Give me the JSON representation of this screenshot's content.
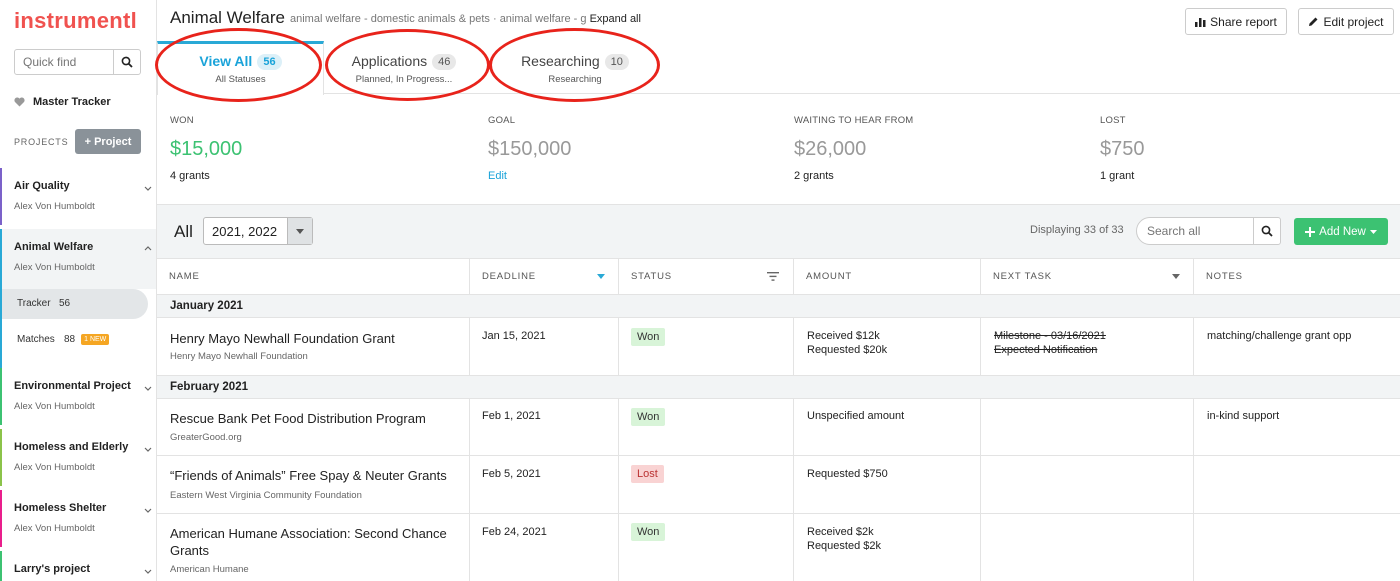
{
  "app": {
    "logo": "instrumentl"
  },
  "sidebar": {
    "quick_find_placeholder": "Quick find",
    "master_tracker": "Master Tracker",
    "projects_header": "PROJECTS",
    "add_project": "+ Project",
    "projects": [
      {
        "name": "Air Quality",
        "owner": "Alex Von Humboldt",
        "color": "#7b61c9"
      },
      {
        "name": "Animal Welfare",
        "owner": "Alex Von Humboldt",
        "color": "#29a9d6"
      },
      {
        "name": "Environmental Project",
        "owner": "Alex Von Humboldt",
        "color": "#3cc272"
      },
      {
        "name": "Homeless and Elderly",
        "owner": "Alex Von Humboldt",
        "color": "#8bc34a"
      },
      {
        "name": "Homeless Shelter",
        "owner": "Alex Von Humboldt",
        "color": "#e91e8c"
      },
      {
        "name": "Larry's project",
        "owner": "",
        "color": "#3cc272"
      }
    ],
    "tracker": {
      "label": "Tracker",
      "count": "56"
    },
    "matches": {
      "label": "Matches",
      "count": "88",
      "badge": "1 NEW"
    }
  },
  "header": {
    "title": "Animal Welfare",
    "subtitle": "animal welfare - domestic animals & pets · animal welfare - g",
    "expand": "Expand all",
    "share_report": "Share report",
    "edit_project": "Edit project"
  },
  "tabs": [
    {
      "label": "View All",
      "count": "56",
      "sub": "All Statuses"
    },
    {
      "label": "Applications",
      "count": "46",
      "sub": "Planned, In Progress..."
    },
    {
      "label": "Researching",
      "count": "10",
      "sub": "Researching"
    }
  ],
  "stats": [
    {
      "label": "WON",
      "value": "$15,000",
      "foot": "4 grants"
    },
    {
      "label": "GOAL",
      "value": "$150,000",
      "foot": "Edit"
    },
    {
      "label": "WAITING TO HEAR FROM",
      "value": "$26,000",
      "foot": "2 grants"
    },
    {
      "label": "LOST",
      "value": "$750",
      "foot": "1 grant"
    }
  ],
  "toolbar": {
    "all_label": "All",
    "year_select": "2021, 2022",
    "displaying": "Displaying 33 of 33",
    "search_placeholder": "Search all",
    "add_new": "Add New"
  },
  "columns": [
    "NAME",
    "DEADLINE",
    "STATUS",
    "AMOUNT",
    "NEXT TASK",
    "NOTES"
  ],
  "groups": [
    {
      "label": "January 2021"
    },
    {
      "label": "February 2021"
    }
  ],
  "rows": [
    {
      "name": "Henry Mayo Newhall Foundation Grant",
      "org": "Henry Mayo Newhall Foundation",
      "deadline": "Jan 15, 2021",
      "status": "Won",
      "amount1": "Received $12k",
      "amount2": "Requested $20k",
      "task1": "Milestone - 03/16/2021",
      "task2": "Expected Notification",
      "notes": "matching/challenge grant opp"
    },
    {
      "name": "Rescue Bank Pet Food Distribution Program",
      "org": "GreaterGood.org",
      "deadline": "Feb 1, 2021",
      "status": "Won",
      "amount1": "Unspecified amount",
      "amount2": "",
      "task1": "",
      "task2": "",
      "notes": "in-kind support"
    },
    {
      "name": "“Friends of Animals” Free Spay & Neuter Grants",
      "org": "Eastern West Virginia Community Foundation",
      "deadline": "Feb 5, 2021",
      "status": "Lost",
      "amount1": "Requested $750",
      "amount2": "",
      "task1": "",
      "task2": "",
      "notes": ""
    },
    {
      "name": "American Humane Association: Second Chance Grants",
      "org": "American Humane",
      "deadline": "Feb 24, 2021",
      "status": "Won",
      "amount1": "Received $2k",
      "amount2": "Requested $2k",
      "task1": "",
      "task2": "",
      "notes": ""
    }
  ],
  "colors": {
    "accent": "#29a9d6",
    "won": "#3cc272",
    "logo": "#f0524f",
    "annotation": "#e8231b"
  }
}
